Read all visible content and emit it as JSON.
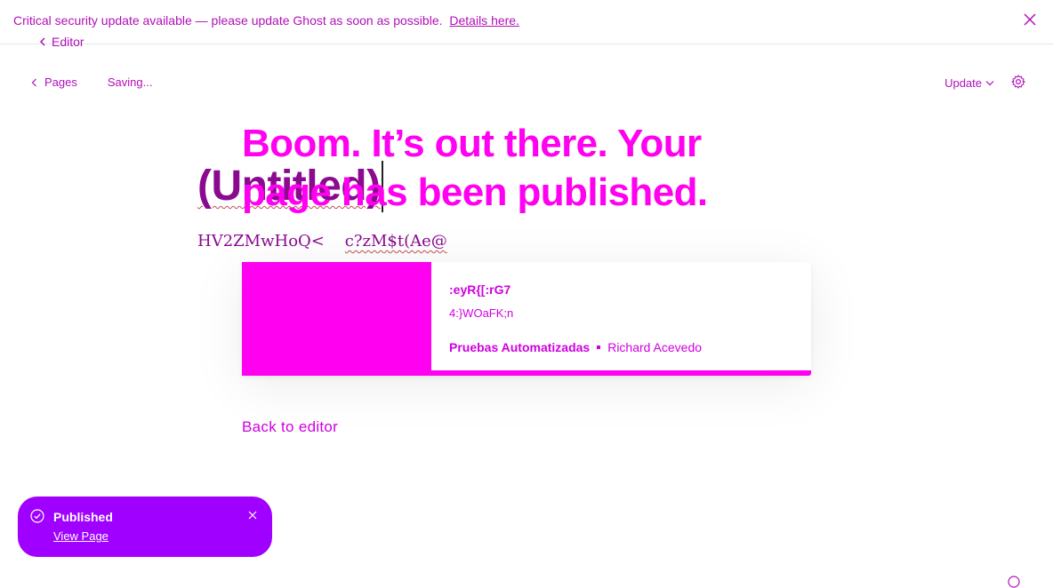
{
  "banner": {
    "message": "Critical security update available — please update Ghost as soon as possible.",
    "link": "Details here.",
    "close_icon": "close-icon"
  },
  "nav": {
    "editor_back": "Editor",
    "pages": "Pages",
    "status": "Saving...",
    "update": "Update"
  },
  "editor": {
    "title": "(Untitled)",
    "body_part1": "HV2ZMwHoQ<",
    "body_part2": "c?zM$t(Ae@"
  },
  "publish": {
    "headline": "Boom. It’s out there. Your page has been published.",
    "card": {
      "title": ":eyR{[:rG7",
      "excerpt": "4:}WOaFK;n",
      "site": "Pruebas Automatizadas",
      "author": "Richard Acevedo"
    },
    "back_link": "Back to editor"
  },
  "toast": {
    "title": "Published",
    "link": "View Page"
  },
  "colors": {
    "accent": "#ff00f0",
    "toast": "#a000ff",
    "text": "#b010b8"
  }
}
